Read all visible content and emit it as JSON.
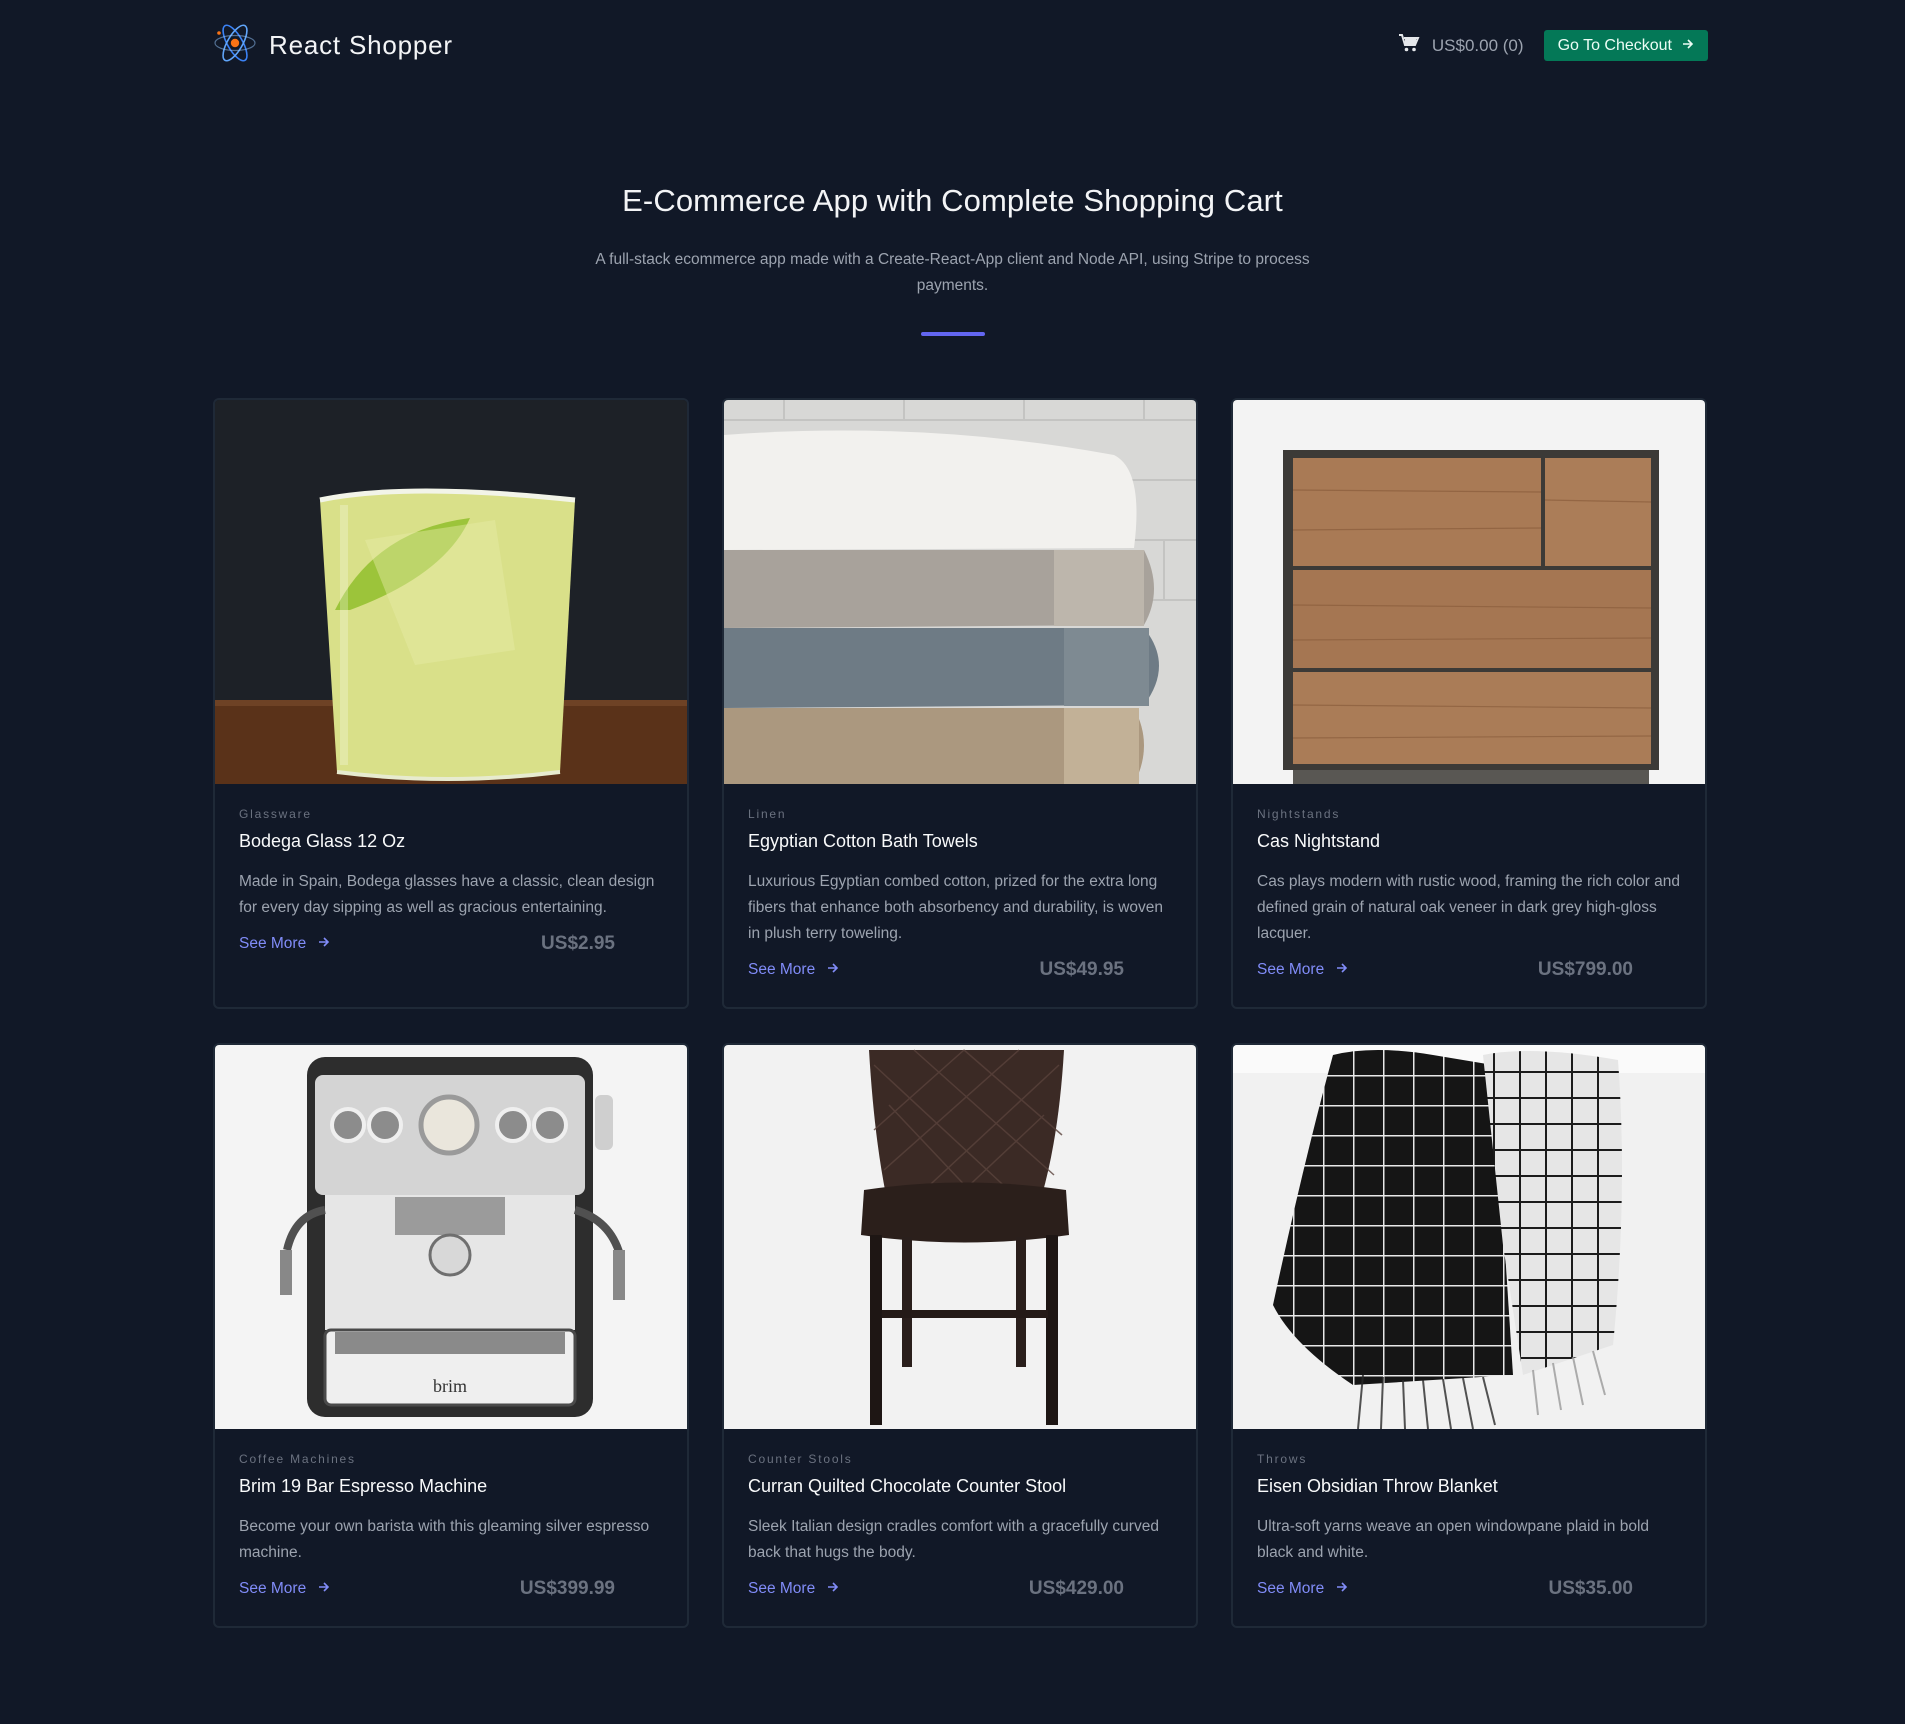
{
  "header": {
    "brand": "React Shopper",
    "cart_total": "US$0.00 (0)",
    "checkout_label": "Go To Checkout"
  },
  "hero": {
    "title": "E-Commerce App with Complete Shopping Cart",
    "subtitle": "A full-stack ecommerce app made with a Create-React-App client and Node API, using Stripe to process payments."
  },
  "colors": {
    "background": "#111827",
    "accent": "#6366f1",
    "checkout": "#047857",
    "link": "#818cf8"
  },
  "products": [
    {
      "category": "Glassware",
      "name": "Bodega Glass 12 Oz",
      "description": "Made in Spain, Bodega glasses have a classic, clean design for every day sipping as well as gracious entertaining.",
      "link": "See More",
      "price": "US$2.95"
    },
    {
      "category": "Linen",
      "name": "Egyptian Cotton Bath Towels",
      "description": "Luxurious Egyptian combed cotton, prized for the extra long fibers that enhance both absorbency and durability, is woven in plush terry toweling.",
      "link": "See More",
      "price": "US$49.95"
    },
    {
      "category": "Nightstands",
      "name": "Cas Nightstand",
      "description": "Cas plays modern with rustic wood, framing the rich color and defined grain of natural oak veneer in dark grey high-gloss lacquer.",
      "link": "See More",
      "price": "US$799.00"
    },
    {
      "category": "Coffee Machines",
      "name": "Brim 19 Bar Espresso Machine",
      "description": "Become your own barista with this gleaming silver espresso machine.",
      "link": "See More",
      "price": "US$399.99",
      "image_text": "brim"
    },
    {
      "category": "Counter Stools",
      "name": "Curran Quilted Chocolate Counter Stool",
      "description": "Sleek Italian design cradles comfort with a gracefully curved back that hugs the body.",
      "link": "See More",
      "price": "US$429.00"
    },
    {
      "category": "Throws",
      "name": "Eisen Obsidian Throw Blanket",
      "description": "Ultra-soft yarns weave an open windowpane plaid in bold black and white.",
      "link": "See More",
      "price": "US$35.00"
    }
  ]
}
